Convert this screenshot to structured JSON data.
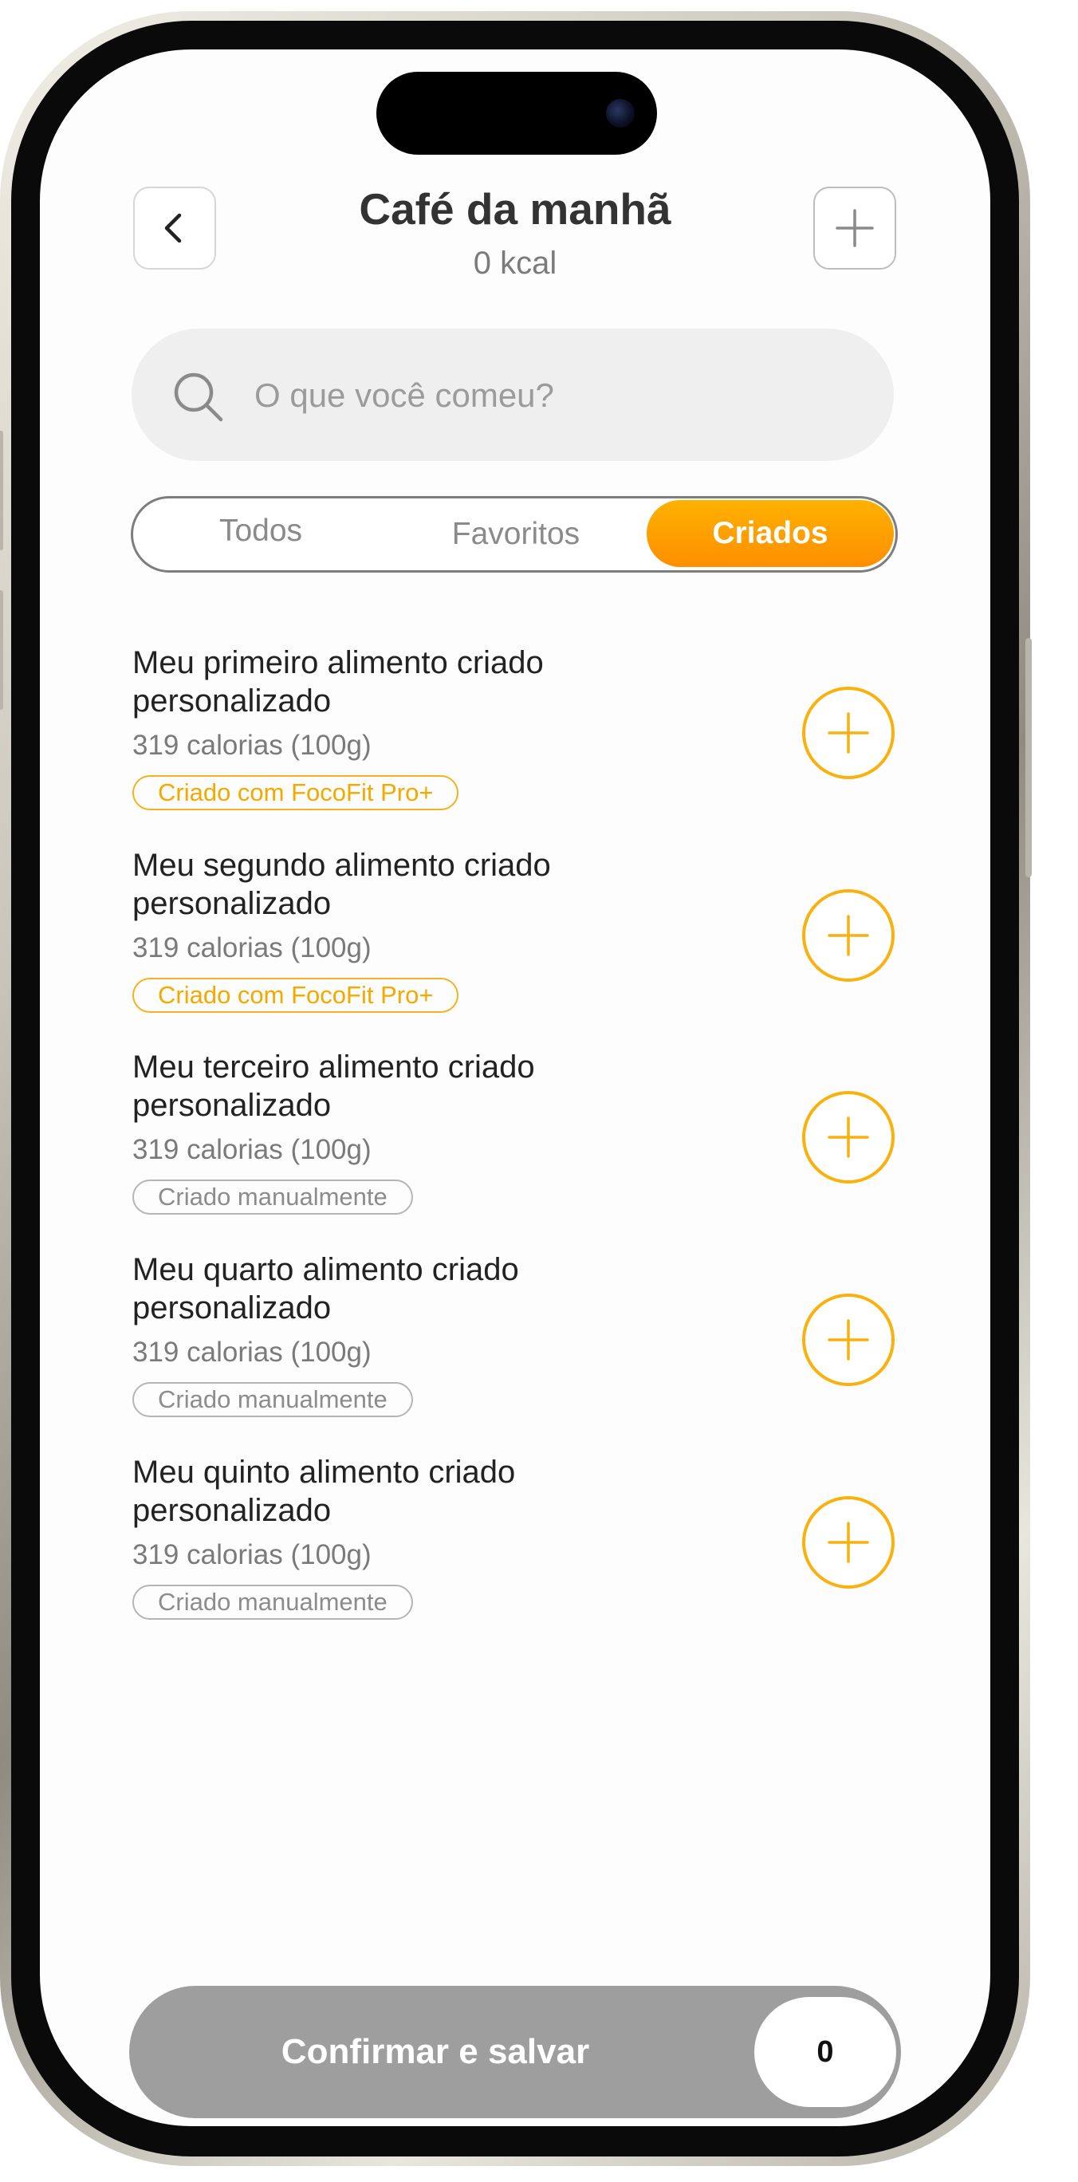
{
  "header": {
    "title": "Café da manhã",
    "subtitle": "0 kcal"
  },
  "search": {
    "placeholder": "O que você comeu?",
    "value": ""
  },
  "tabs": [
    {
      "label": "Todos",
      "active": false
    },
    {
      "label": "Favoritos",
      "active": false
    },
    {
      "label": "Criados",
      "active": true
    }
  ],
  "foods": [
    {
      "name": "Meu primeiro alimento criado personalizado",
      "calories": "319 calorias (100g)",
      "badge": "Criado com FocoFit Pro+",
      "badge_type": "pro"
    },
    {
      "name": "Meu segundo alimento criado personalizado",
      "calories": "319 calorias (100g)",
      "badge": "Criado com FocoFit Pro+",
      "badge_type": "pro"
    },
    {
      "name": "Meu terceiro alimento criado personalizado",
      "calories": "319 calorias (100g)",
      "badge": "Criado manualmente",
      "badge_type": "manual"
    },
    {
      "name": "Meu quarto alimento criado personalizado",
      "calories": "319 calorias (100g)",
      "badge": "Criado manualmente",
      "badge_type": "manual"
    },
    {
      "name": "Meu quinto alimento criado personalizado",
      "calories": "319 calorias (100g)",
      "badge": "Criado manualmente",
      "badge_type": "manual"
    }
  ],
  "footer": {
    "confirm_label": "Confirmar e salvar",
    "count": "0"
  },
  "icons": {
    "back": "chevron-left-icon",
    "add": "plus-icon",
    "search": "search-icon",
    "add_food": "plus-circle-icon"
  },
  "colors": {
    "accent": "#FFA500",
    "accent_border": "#F9B10F",
    "confirm_bar": "#9E9E9E",
    "search_bg": "#EFEFEF"
  }
}
